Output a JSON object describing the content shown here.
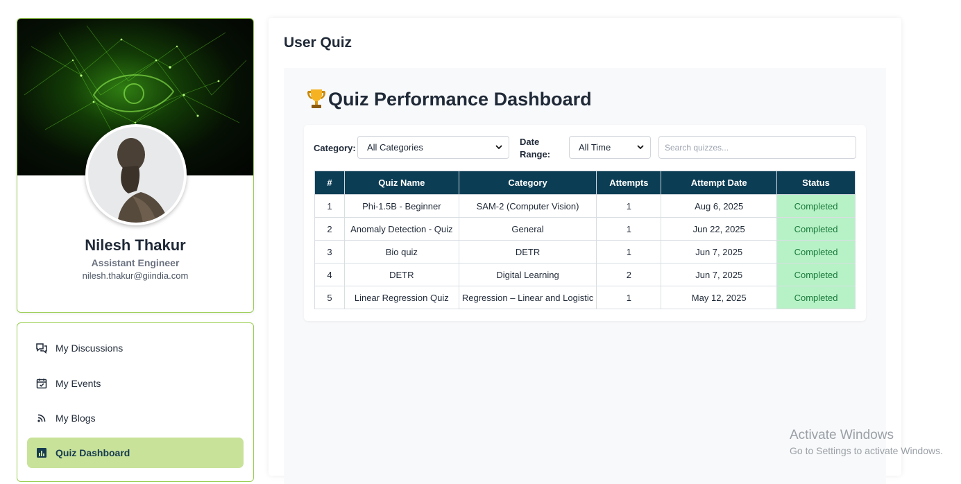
{
  "profile": {
    "name": "Nilesh Thakur",
    "role": "Assistant Engineer",
    "email": "nilesh.thakur@giindia.com"
  },
  "nav": {
    "items": [
      {
        "label": "My Discussions",
        "icon": "discussion-icon"
      },
      {
        "label": "My Events",
        "icon": "calendar-check-icon"
      },
      {
        "label": "My Blogs",
        "icon": "rss-icon"
      },
      {
        "label": "Quiz Dashboard",
        "icon": "bar-chart-icon",
        "active": true
      }
    ]
  },
  "page": {
    "title": "User Quiz"
  },
  "dashboard": {
    "title": "Quiz Performance Dashboard",
    "title_icon": "trophy-icon",
    "filters": {
      "category_label": "Category:",
      "category_value": "All Categories",
      "date_label_line1": "Date",
      "date_label_line2": "Range:",
      "date_value": "All Time",
      "search_placeholder": "Search quizzes..."
    },
    "table": {
      "headers": [
        "#",
        "Quiz Name",
        "Category",
        "Attempts",
        "Attempt Date",
        "Status"
      ],
      "rows": [
        [
          "1",
          "Phi-1.5B - Beginner",
          "SAM-2 (Computer Vision)",
          "1",
          "Aug 6, 2025",
          "Completed"
        ],
        [
          "2",
          "Anomaly Detection - Quiz",
          "General",
          "1",
          "Jun 22, 2025",
          "Completed"
        ],
        [
          "3",
          "Bio quiz",
          "DETR",
          "1",
          "Jun 7, 2025",
          "Completed"
        ],
        [
          "4",
          "DETR",
          "Digital Learning",
          "2",
          "Jun 7, 2025",
          "Completed"
        ],
        [
          "5",
          "Linear Regression Quiz",
          "Regression – Linear and Logistic",
          "1",
          "May 12, 2025",
          "Completed"
        ]
      ]
    }
  },
  "watermark": {
    "line1": "Activate Windows",
    "line2": "Go to Settings to activate Windows."
  },
  "colors": {
    "accent_green": "#c8e29a",
    "border_green": "#9acd52",
    "table_header": "#0b3d55",
    "status_bg": "#b7f2c7"
  }
}
